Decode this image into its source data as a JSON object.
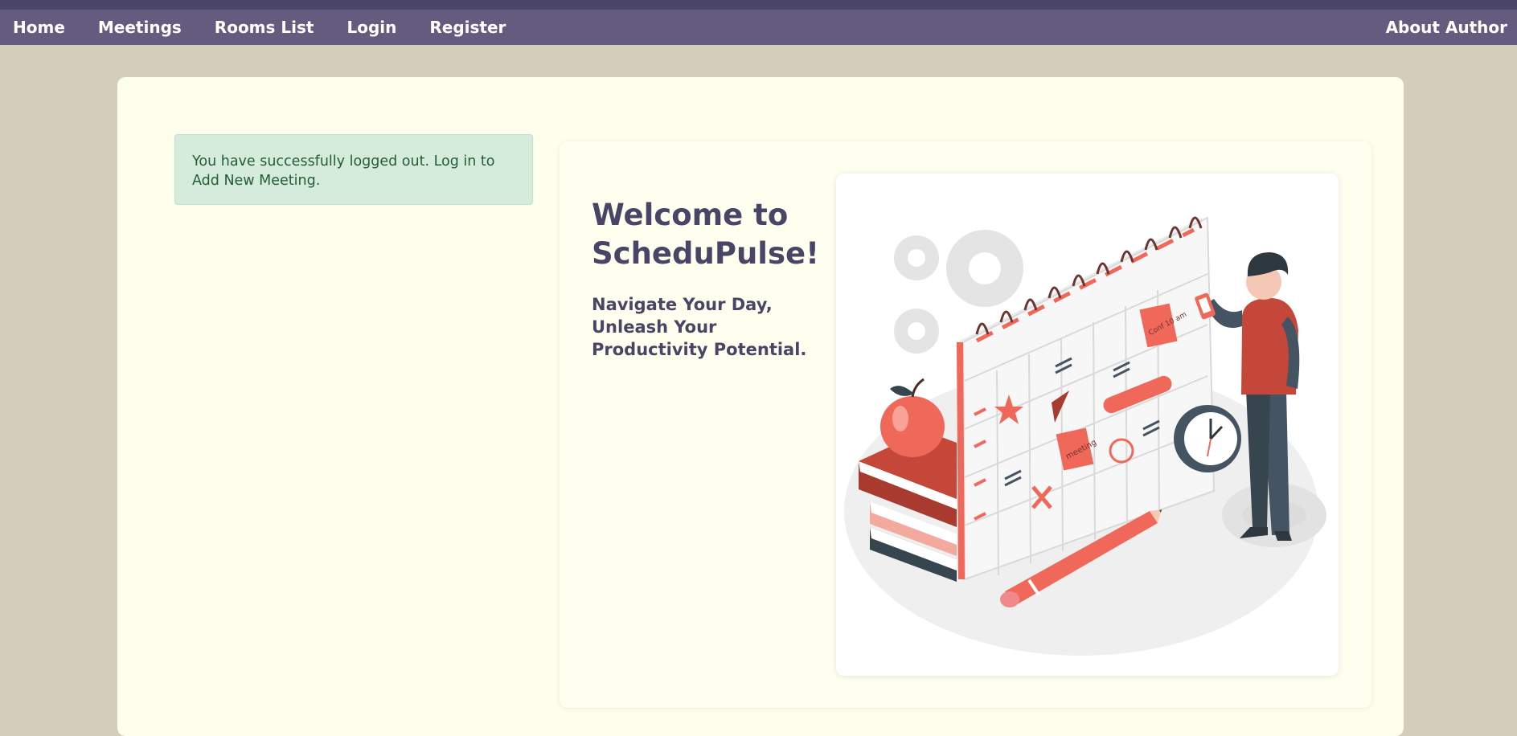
{
  "nav": {
    "left_items": [
      {
        "label": "Home"
      },
      {
        "label": "Meetings"
      },
      {
        "label": "Rooms List"
      },
      {
        "label": "Login"
      },
      {
        "label": "Register"
      }
    ],
    "right_item": {
      "label": "About Author"
    }
  },
  "alert": {
    "message": "You have successfully logged out. Log in to Add New Meeting."
  },
  "hero": {
    "title": "Welcome to ScheduPulse!",
    "subtitle": "Navigate Your Day, Unleash Your Productivity Potential."
  },
  "illustration": {
    "note_text_1": "Conf 10 am",
    "note_text_2": "meeting"
  },
  "colors": {
    "nav_bg": "#655b7e",
    "nav_top": "#4b4668",
    "page_bg": "#d4cdb9",
    "card_bg": "#fefeec",
    "title": "#4a4566",
    "alert_bg": "#d5ecdc",
    "alert_text": "#235d34",
    "accent": "#f0685a"
  }
}
